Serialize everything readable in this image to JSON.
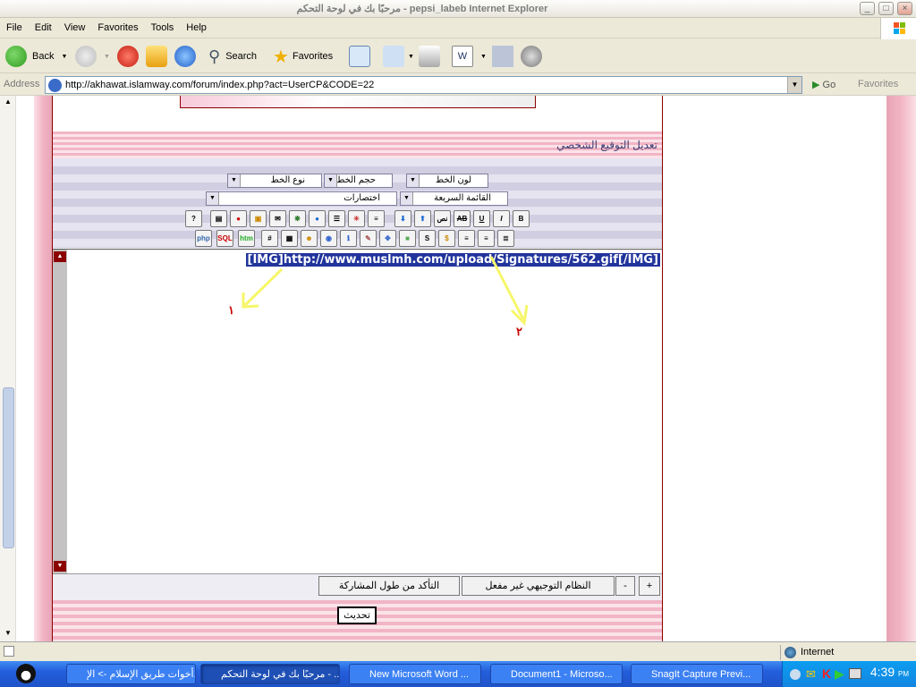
{
  "window": {
    "title": "مرحبًا بك في لوحة التحكم - pepsi_labeb Internet Explorer"
  },
  "menu": [
    "File",
    "Edit",
    "View",
    "Favorites",
    "Tools",
    "Help"
  ],
  "toolbar": {
    "back": "Back",
    "search": "Search",
    "favorites": "Favorites"
  },
  "address": {
    "label": "Address",
    "url": "http://akhawat.islamway.com/forum/index.php?act=UserCP&CODE=22",
    "go": "Go",
    "favorites": "Favorites"
  },
  "page": {
    "heading": "تعديل التوقيع الشخصي",
    "selects": {
      "font_type": "نوع الخط",
      "font_size": "حجم الخط",
      "font_color": "لون الخط",
      "quick_list": "القائمة السريعة",
      "shortcuts": "اختصارات"
    },
    "buttons_row1": [
      "B",
      "I",
      "U",
      "AB",
      "نص",
      "",
      "",
      "",
      "",
      "",
      "",
      "",
      "",
      "",
      "",
      "",
      "",
      "",
      ""
    ],
    "buttons_row2": [
      "",
      "",
      "",
      "$",
      "",
      "",
      "",
      "",
      "",
      "",
      "",
      "",
      "#",
      "htm",
      "SQL",
      "php"
    ],
    "selected_text": "[IMG]http://www.muslmh.com/upload/Signatures/562.gif[/IMG]",
    "annotation_1": "١",
    "annotation_2": "٢",
    "bottom": {
      "plus": "+",
      "minus": "-",
      "guided": "النظام التوجيهي غير مفعل",
      "check_length": "التأكد من طول المشاركة"
    },
    "submit": "تحديث"
  },
  "status": {
    "zone": "Internet"
  },
  "taskbar": {
    "tasks": [
      "أخوات طريق الإسلام -> الإ...",
      "مرحبًا بك في لوحة التحكم - ...",
      "New Microsoft Word ...",
      "Document1 - Microso...",
      "SnagIt Capture Previ..."
    ],
    "clock": "4:39",
    "ampm": "PM"
  }
}
